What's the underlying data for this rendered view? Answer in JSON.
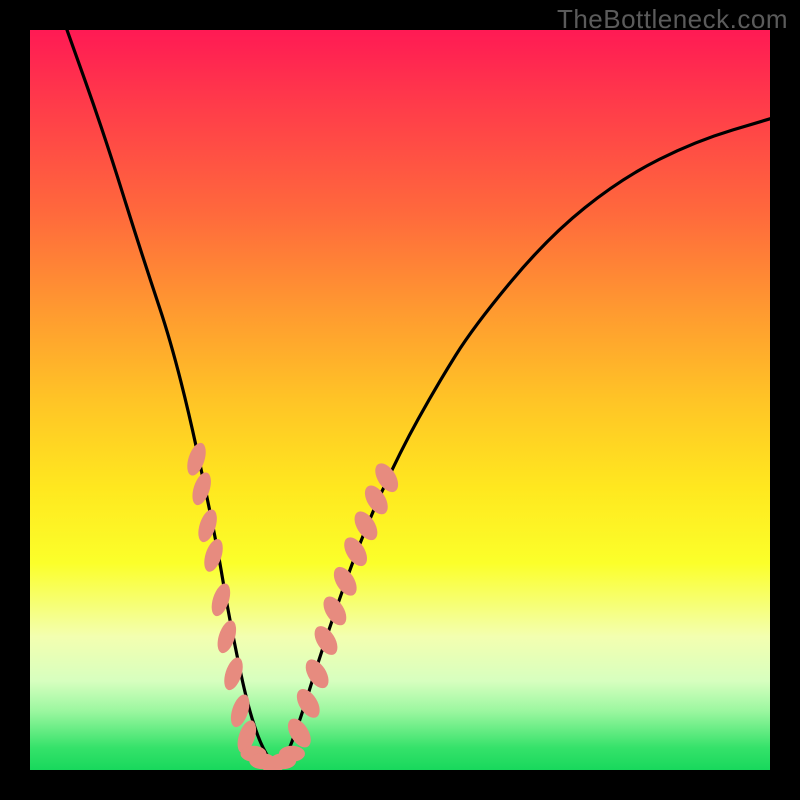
{
  "watermark": "TheBottleneck.com",
  "colors": {
    "curve_black": "#000000",
    "dot_salmon": "#e78b7f"
  },
  "chart_data": {
    "type": "line",
    "title": "",
    "xlabel": "",
    "ylabel": "",
    "xlim": [
      0,
      100
    ],
    "ylim": [
      0,
      100
    ],
    "grid": false,
    "legend": false,
    "series": [
      {
        "name": "bottleneck-curve",
        "x": [
          5,
          10,
          15,
          20,
          25,
          27,
          30,
          33,
          35,
          40,
          45,
          50,
          55,
          60,
          70,
          80,
          90,
          100
        ],
        "y": [
          100,
          86,
          70,
          55,
          32,
          20,
          6,
          0,
          2,
          18,
          32,
          43,
          52,
          60,
          72,
          80,
          85,
          88
        ]
      }
    ],
    "annotations": {
      "left_band_dots": [
        {
          "x": 22.5,
          "y": 42
        },
        {
          "x": 23.2,
          "y": 38
        },
        {
          "x": 24.0,
          "y": 33
        },
        {
          "x": 24.8,
          "y": 29
        },
        {
          "x": 25.8,
          "y": 23
        },
        {
          "x": 26.6,
          "y": 18
        },
        {
          "x": 27.5,
          "y": 13
        },
        {
          "x": 28.4,
          "y": 8
        },
        {
          "x": 29.3,
          "y": 4.5
        }
      ],
      "bottom_dots": [
        {
          "x": 30.2,
          "y": 2.2
        },
        {
          "x": 31.4,
          "y": 1.2
        },
        {
          "x": 32.8,
          "y": 0.8
        },
        {
          "x": 34.2,
          "y": 1.2
        },
        {
          "x": 35.4,
          "y": 2.2
        }
      ],
      "right_band_dots": [
        {
          "x": 36.4,
          "y": 5
        },
        {
          "x": 37.6,
          "y": 9
        },
        {
          "x": 38.8,
          "y": 13
        },
        {
          "x": 40.0,
          "y": 17.5
        },
        {
          "x": 41.2,
          "y": 21.5
        },
        {
          "x": 42.6,
          "y": 25.5
        },
        {
          "x": 44.0,
          "y": 29.5
        },
        {
          "x": 45.4,
          "y": 33
        },
        {
          "x": 46.8,
          "y": 36.5
        },
        {
          "x": 48.2,
          "y": 39.5
        }
      ]
    }
  }
}
